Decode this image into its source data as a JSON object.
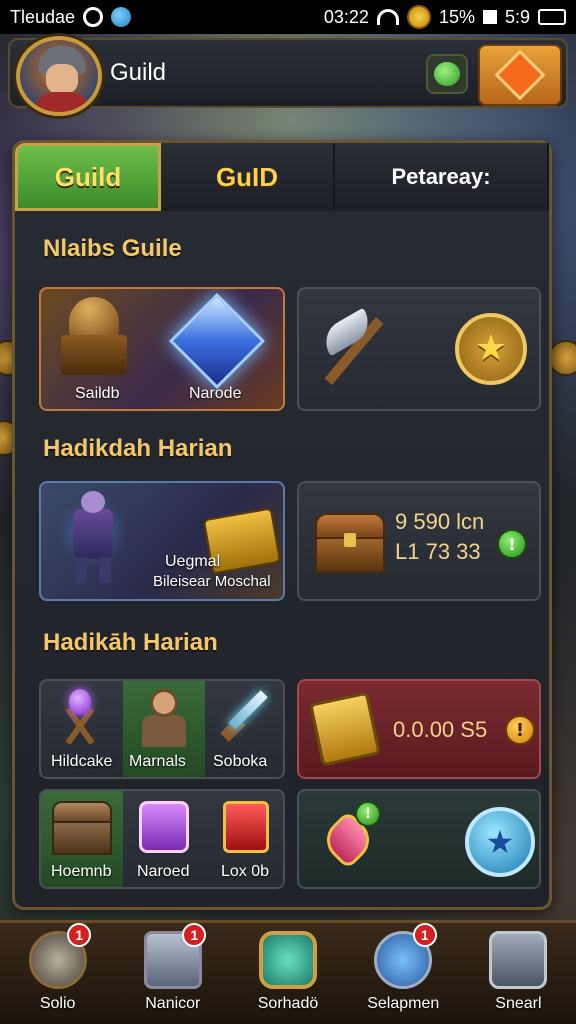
{
  "status_bar": {
    "carrier": "Tleudae",
    "time": "03:22",
    "battery_percent": "15%",
    "clock": "5:9"
  },
  "header": {
    "title": "Guild"
  },
  "tabs": [
    {
      "label": "Guild"
    },
    {
      "label": "GuID"
    },
    {
      "label": "Petareay:"
    }
  ],
  "sections": [
    {
      "title": "Nlaibs Guile",
      "left_card": {
        "labels": [
          "Saildb",
          "Narode"
        ]
      },
      "right_card": {}
    },
    {
      "title": "Hadikdah Harian",
      "left_card": {
        "labels": [
          "Uegmal",
          "Bileisear Moschal"
        ]
      },
      "right_card": {
        "value_1": "9 590 lcn",
        "value_2": "L1 73 33",
        "badge": "!"
      }
    },
    {
      "title": "Hadikāh Harian",
      "row1_left": {
        "labels": [
          "Hildcake",
          "Marnals",
          "Soboka"
        ]
      },
      "row1_right": {
        "price": "0.0.00 S5",
        "badge": "!"
      },
      "row2_left": {
        "labels": [
          "Hoemnb",
          "Naroed",
          "Lox 0b"
        ]
      },
      "row2_right": {
        "badge": "!"
      }
    }
  ],
  "bottom_nav": [
    {
      "label": "Solio",
      "badge": "1"
    },
    {
      "label": "Nanicor",
      "badge": "1"
    },
    {
      "label": "Sorhadö",
      "badge": ""
    },
    {
      "label": "Selapmen",
      "badge": "1"
    },
    {
      "label": "Snearl",
      "badge": ""
    }
  ],
  "colors": {
    "accent_gold": "#f2c86a",
    "tab_active": "#6fbf4a",
    "alert_red": "#d42020"
  },
  "icons": [
    "gear-icon",
    "drop-icon",
    "coin-icon",
    "wifi-icon",
    "battery-icon",
    "avatar",
    "slime-icon",
    "diamond-icon",
    "altar-icon",
    "gem-icon",
    "axe-icon",
    "star-coin-icon",
    "warrior-icon",
    "book-icon",
    "chest-icon",
    "staff-icon",
    "bandit-icon",
    "sword-icon",
    "purple-box-icon",
    "red-box-icon",
    "gold-badge-icon",
    "heart-icon",
    "blue-star-icon"
  ]
}
